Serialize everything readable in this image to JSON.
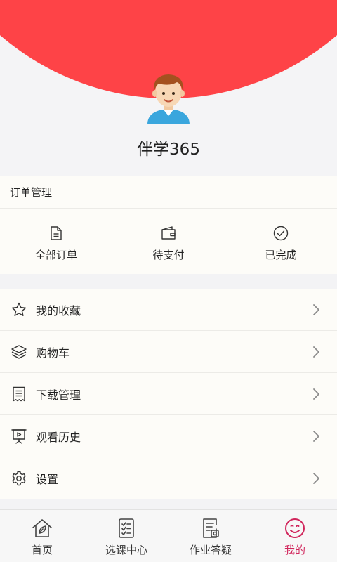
{
  "profile": {
    "username": "伴学365"
  },
  "orders": {
    "title": "订单管理",
    "items": [
      {
        "label": "全部订单",
        "icon": "document-icon"
      },
      {
        "label": "待支付",
        "icon": "wallet-icon"
      },
      {
        "label": "已完成",
        "icon": "check-circle-icon"
      }
    ]
  },
  "menu": {
    "items": [
      {
        "label": "我的收藏",
        "icon": "star-icon"
      },
      {
        "label": "购物车",
        "icon": "layers-icon"
      },
      {
        "label": "下载管理",
        "icon": "receipt-icon"
      },
      {
        "label": "观看历史",
        "icon": "presentation-icon"
      },
      {
        "label": "设置",
        "icon": "gear-icon"
      }
    ]
  },
  "tabbar": {
    "items": [
      {
        "label": "首页",
        "icon": "home-icon",
        "active": false
      },
      {
        "label": "选课中心",
        "icon": "checklist-icon",
        "active": false
      },
      {
        "label": "作业答疑",
        "icon": "homework-icon",
        "active": false
      },
      {
        "label": "我的",
        "icon": "smile-icon",
        "active": true
      }
    ]
  },
  "colors": {
    "brand_red": "#fe4347",
    "active_tab": "#d1265c",
    "icon_gray": "#333333"
  }
}
